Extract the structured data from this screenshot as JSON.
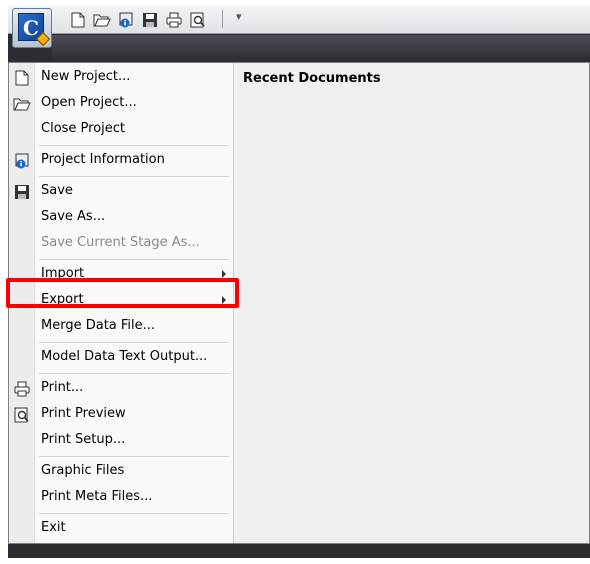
{
  "app": {
    "button_letter": "C"
  },
  "quick_access": [
    "new-icon",
    "open-icon",
    "project-info-icon",
    "save-icon",
    "print-icon",
    "print-preview-icon"
  ],
  "recent": {
    "title": "Recent Documents"
  },
  "menu": {
    "new_project": "New Project...",
    "open_project": "Open Project...",
    "close_project": "Close Project",
    "project_information": "Project Information",
    "save": "Save",
    "save_as": "Save As...",
    "save_stage": "Save Current Stage As...",
    "import": "Import",
    "export": "Export",
    "merge": "Merge Data File...",
    "model_text": "Model Data Text Output...",
    "print": "Print...",
    "print_preview": "Print Preview",
    "print_setup": "Print Setup...",
    "graphic_files": "Graphic Files",
    "print_meta": "Print Meta Files...",
    "exit": "Exit"
  },
  "colors": {
    "highlight": "#ff0000",
    "frame": "#2b2d31"
  }
}
